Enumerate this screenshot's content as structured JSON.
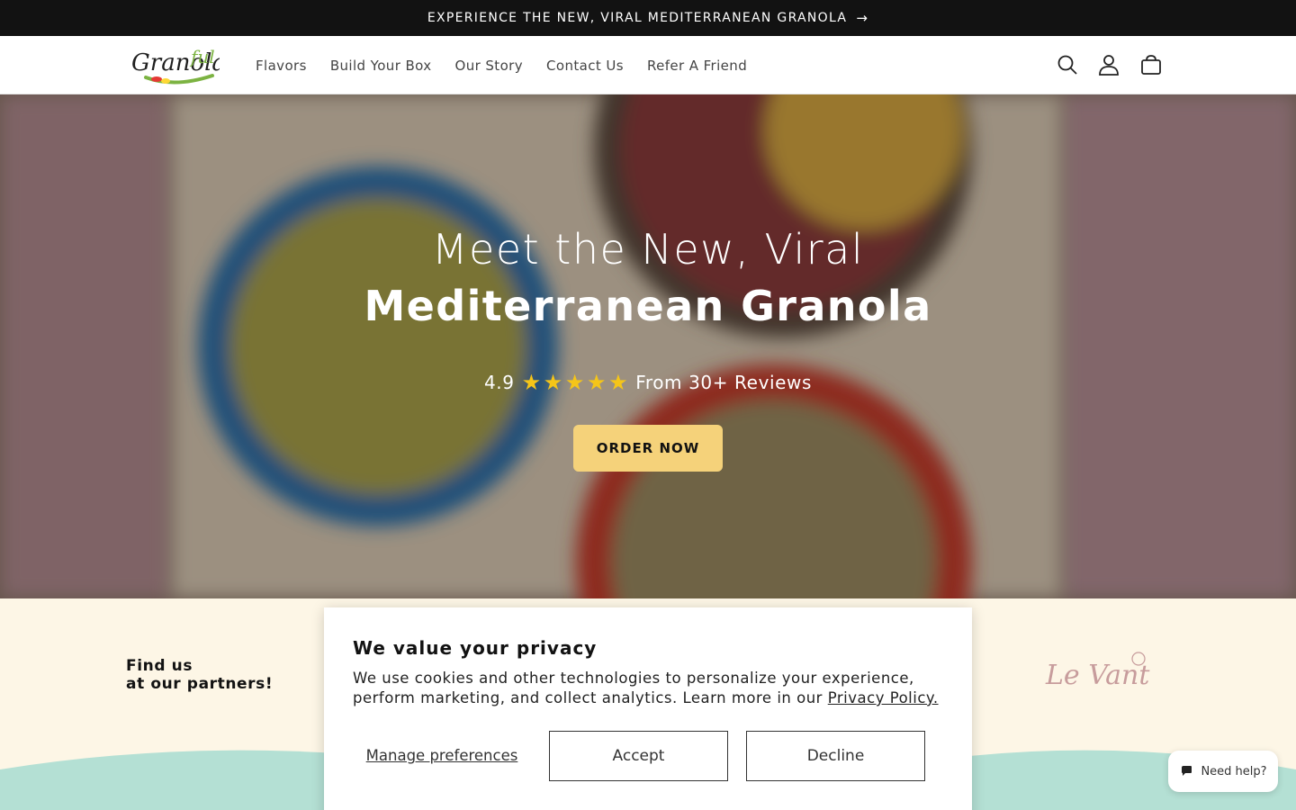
{
  "announcement": {
    "text": "EXPERIENCE THE NEW, VIRAL MEDITERRANEAN GRANOLA",
    "arrow": "→"
  },
  "header": {
    "logo_text": "Granolaful",
    "nav": [
      {
        "label": "Flavors"
      },
      {
        "label": "Build Your Box"
      },
      {
        "label": "Our Story"
      },
      {
        "label": "Contact Us"
      },
      {
        "label": "Refer A Friend"
      }
    ],
    "icons": [
      "search-icon",
      "account-icon",
      "cart-icon"
    ]
  },
  "hero": {
    "title_line1": "Meet the New, Viral",
    "title_line2": "Mediterranean Granola",
    "rating_value": "4.9",
    "stars": 5,
    "rating_text": "From 30+ Reviews",
    "cta": "ORDER NOW",
    "cta_color": "#f5d27a"
  },
  "partners": {
    "heading_line1": "Find us",
    "heading_line2": "at our partners!",
    "partner_logo": "Le Vant"
  },
  "cookie_banner": {
    "title": "We value your privacy",
    "text": "We use cookies and other technologies to personalize your experience, perform marketing, and collect analytics. Learn more in our",
    "link": "Privacy Policy.",
    "manage": "Manage preferences",
    "accept": "Accept",
    "decline": "Decline"
  },
  "help_widget": {
    "label": "Need help?"
  },
  "colors": {
    "announcement_bg": "#121212",
    "cta": "#f5d27a",
    "wave": "#b4e0d4",
    "cream": "#fdf6e6"
  }
}
